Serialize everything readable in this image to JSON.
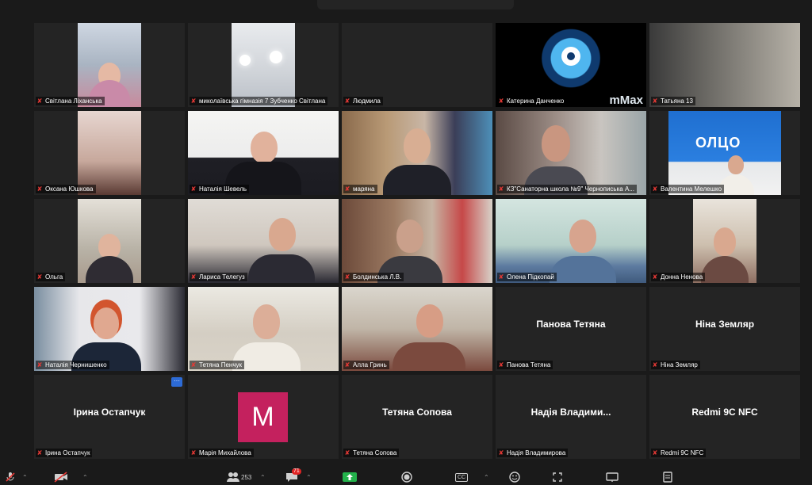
{
  "tiles": [
    {
      "name": "Світлана Ліханська"
    },
    {
      "name": "миколаївська гімназія 7 Зубченко Світлана"
    },
    {
      "name": "Людмила"
    },
    {
      "name": "Катерина Данченко"
    },
    {
      "name": "Татьяна 13"
    },
    {
      "name": "Оксана Юшкова"
    },
    {
      "name": "Наталія Шевель"
    },
    {
      "name": "маряна"
    },
    {
      "name": "КЗ\"Санаторна школа №9\" Чернописька А..."
    },
    {
      "name": "Валентина Мелешко"
    },
    {
      "name": "Ольга"
    },
    {
      "name": "Лариса Телегуз"
    },
    {
      "name": "Болдинська Л.В."
    },
    {
      "name": "Олена Підкопай"
    },
    {
      "name": "Донна Ненова"
    },
    {
      "name": "Наталія Чернишенко"
    },
    {
      "name": "Тетяна Пенчук"
    },
    {
      "name": "Алла Гринь"
    },
    {
      "name": "Панова Тетяна",
      "display": "Панова Тетяна"
    },
    {
      "name": "Ніна Земляр",
      "display": "Ніна Земляр"
    },
    {
      "name": "Ірина Остапчук",
      "display": "Ірина Остапчук"
    },
    {
      "name": "Марія Михайлова",
      "avatar_letter": "M"
    },
    {
      "name": "Тетяна Сопова",
      "display": "Тетяна Сопова"
    },
    {
      "name": "Надія Владимирова",
      "display": "Надія  Владими..."
    },
    {
      "name": "Redmi 9C NFC",
      "display": "Redmi 9C NFC"
    }
  ],
  "tile_more_label": "···",
  "videos": {
    "webcammax_overlay": "mMax",
    "olympic_logo": "ОЛЦО"
  },
  "toolbar": {
    "participants_count": "253",
    "chat_badge": "71",
    "cc_label": "CC"
  },
  "colors": {
    "muted_red": "#e53935",
    "share_green": "#23b24b",
    "avatar_magenta": "#c4215e",
    "more_blue": "#2d6bd6"
  }
}
